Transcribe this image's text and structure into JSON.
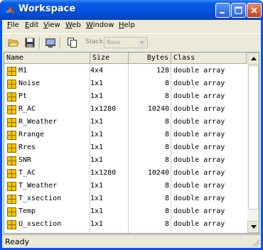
{
  "window": {
    "title": "Workspace"
  },
  "menu": [
    "File",
    "Edit",
    "View",
    "Web",
    "Window",
    "Help"
  ],
  "toolbar": {
    "icons": [
      "open-folder-icon",
      "save-icon",
      "import-data-icon",
      "copy-icon"
    ],
    "stack_label": "Stack:",
    "stack_value": "Base"
  },
  "table": {
    "columns": [
      "Name",
      "Size",
      "Bytes",
      "Class"
    ],
    "rows": [
      {
        "name": "M1",
        "size": "4x4",
        "bytes": "128",
        "class": "double array"
      },
      {
        "name": "Noise",
        "size": "1x1",
        "bytes": "8",
        "class": "double array"
      },
      {
        "name": "Pt",
        "size": "1x1",
        "bytes": "8",
        "class": "double array"
      },
      {
        "name": "R_AC",
        "size": "1x1280",
        "bytes": "10240",
        "class": "double array"
      },
      {
        "name": "R_Weather",
        "size": "1x1",
        "bytes": "8",
        "class": "double array"
      },
      {
        "name": "Rrange",
        "size": "1x1",
        "bytes": "8",
        "class": "double array"
      },
      {
        "name": "Rres",
        "size": "1x1",
        "bytes": "8",
        "class": "double array"
      },
      {
        "name": "SNR",
        "size": "1x1",
        "bytes": "8",
        "class": "double array"
      },
      {
        "name": "T_AC",
        "size": "1x1280",
        "bytes": "10240",
        "class": "double array"
      },
      {
        "name": "T_Weather",
        "size": "1x1",
        "bytes": "8",
        "class": "double array"
      },
      {
        "name": "T_xsection",
        "size": "1x1",
        "bytes": "8",
        "class": "double array"
      },
      {
        "name": "Temp",
        "size": "1x1",
        "bytes": "8",
        "class": "double array"
      },
      {
        "name": "U_xsection",
        "size": "1x1",
        "bytes": "8",
        "class": "double array"
      }
    ]
  },
  "status": {
    "text": "Ready"
  },
  "colors": {
    "title_bar": "#0053e0",
    "chrome": "#ece9d8",
    "var_icon": "#f5c400"
  }
}
